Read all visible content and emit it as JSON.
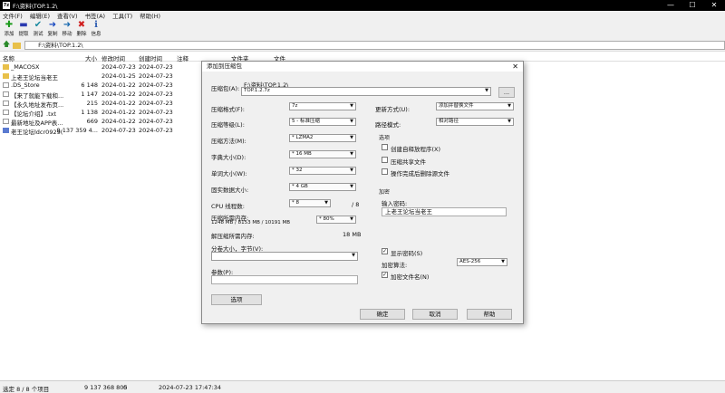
{
  "window": {
    "title": "F:\\资料\\TOP.1.2\\",
    "app_icon": "7z"
  },
  "menu": [
    "文件(F)",
    "编辑(E)",
    "查看(V)",
    "书签(A)",
    "工具(T)",
    "帮助(H)"
  ],
  "toolbar": [
    {
      "label": "添加",
      "icon": "plus-icon",
      "glyph": "✚",
      "color": "#1a9a1a"
    },
    {
      "label": "提取",
      "icon": "minus-icon",
      "glyph": "▬",
      "color": "#2a3ab0"
    },
    {
      "label": "测试",
      "icon": "check-icon",
      "glyph": "✔",
      "color": "#1a8aa0"
    },
    {
      "label": "复制",
      "icon": "arrow-right-icon",
      "glyph": "➜",
      "color": "#1a4ac0"
    },
    {
      "label": "移动",
      "icon": "arrow-right-icon",
      "glyph": "➜",
      "color": "#1a6ab0"
    },
    {
      "label": "删除",
      "icon": "x-icon",
      "glyph": "✖",
      "color": "#d02020"
    },
    {
      "label": "信息",
      "icon": "info-icon",
      "glyph": "ℹ",
      "color": "#2a5ab0"
    }
  ],
  "address": {
    "path": "F:\\资料\\TOP.1.2\\"
  },
  "columns": {
    "name": "名称",
    "size": "大小",
    "modified": "修改时间",
    "created": "创建时间",
    "comment": "注释",
    "folders": "文件夹",
    "files": "文件"
  },
  "files": [
    {
      "name": "_MACOSX",
      "size": "",
      "modified": "2024-07-23...",
      "created": "2024-07-23...",
      "type": "folder"
    },
    {
      "name": "上老王论坛当老王",
      "size": "",
      "modified": "2024-01-25...",
      "created": "2024-07-23...",
      "type": "folder"
    },
    {
      "name": ".DS_Store",
      "size": "6 148",
      "modified": "2024-01-22...",
      "created": "2024-07-23...",
      "type": "file"
    },
    {
      "name": "【来了就能下载和...",
      "size": "1 147",
      "modified": "2024-01-22...",
      "created": "2024-07-23...",
      "type": "file"
    },
    {
      "name": "【永久地址发布页...",
      "size": "215",
      "modified": "2024-01-22...",
      "created": "2024-07-23...",
      "type": "file"
    },
    {
      "name": "【论坛介绍】.txt",
      "size": "1 138",
      "modified": "2024-01-22...",
      "created": "2024-07-23...",
      "type": "file"
    },
    {
      "name": "最新地址及APP表...",
      "size": "669",
      "modified": "2024-01-22...",
      "created": "2024-07-23...",
      "type": "file"
    },
    {
      "name": "老王论坛ldcr0929(...",
      "size": "9 137 359 4...",
      "modified": "2024-07-23...",
      "created": "2024-07-23...",
      "type": "archive"
    }
  ],
  "status": {
    "selected": "选定 8 / 8 个项目",
    "size": "9 137 368 805",
    "count": "0",
    "date": "2024-07-23 17:47:34"
  },
  "dialog": {
    "title": "添加到压缩包",
    "close": "✕",
    "archive_label": "压缩包(A):",
    "archive_dir": "F:\\资料\\TOP.1.2\\",
    "archive_name": "TOP.1.2.7z",
    "browse": "...",
    "format_label": "压缩格式(F):",
    "format": "7z",
    "level_label": "压缩等级(L):",
    "level": "5 - 标准压缩",
    "method_label": "压缩方法(M):",
    "method": "* LZMA2",
    "dict_label": "字典大小(D):",
    "dict": "* 16 MB",
    "word_label": "单词大小(W):",
    "word": "* 32",
    "solid_label": "固实数据大小:",
    "solid": "* 4 GB",
    "cpu_label": "CPU 线程数:",
    "cpu": "* 8",
    "cpu_max": "/ 8",
    "mem_label": "压缩所需内存:",
    "mem_detail": "1248 MB / 8153 MB / 10191 MB",
    "mem_pct": "* 80%",
    "decmem_label": "解压缩所需内存:",
    "decmem": "18 MB",
    "split_label": "分卷大小，字节(V):",
    "params_label": "参数(P):",
    "options_button": "选项",
    "update_label": "更新方式(U):",
    "update": "添加并替换文件",
    "pathmode_label": "路径模式:",
    "pathmode": "相对路径",
    "options_group": "选项",
    "opt_sfx": "创建自释放程序(X)",
    "opt_shared": "压缩共享文件",
    "opt_delete": "操作完成后删除源文件",
    "encrypt_group": "加密",
    "password_label": "输入密码:",
    "password": "上老王论坛当老王",
    "show_password": "显示密码(S)",
    "enc_method_label": "加密算法:",
    "enc_method": "AES-256",
    "encrypt_names": "加密文件名(N)",
    "ok": "确定",
    "cancel": "取消",
    "help": "帮助"
  }
}
